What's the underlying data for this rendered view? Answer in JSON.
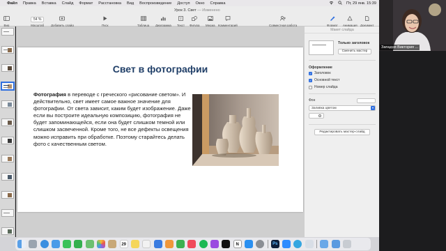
{
  "menubar": {
    "apple": "",
    "items": [
      "Файл",
      "Правка",
      "Вставка",
      "Слайд",
      "Формат",
      "Расстановка",
      "Вид",
      "Воспроизведение",
      "Доступ",
      "Окно",
      "Справка"
    ],
    "clock": "Пт, 29 янв. 15:39"
  },
  "document": {
    "title": "Урок 3. Свет",
    "status": "— Изменено"
  },
  "toolbar": {
    "view": "Вид",
    "zoom_value": "54 %",
    "zoom": "Масштаб",
    "add_slide": "Добавить слайд",
    "play": "Пуск",
    "table": "Таблица",
    "chart": "Диаграмма",
    "text": "Текст",
    "shape": "Фигура",
    "media": "Медиа",
    "comment": "Комментарий",
    "collaborate": "Совместная работа",
    "format": "Формат",
    "animate": "Анимация",
    "document": "Документ"
  },
  "slide": {
    "title": "Свет в фотографии",
    "body_term": "Фотография",
    "body_rest": " в переводе с греческого «рисование светом». И действительно, свет имеет самое важное значение для фотографии. От света зависит, каким будет изображение. Даже если вы построите идеальную композицию, фотография не будет запоминающейся, если она будет слишком темной или слишком засвеченной. Кроме того, не все дефекты освещения можно исправить при обработке. Поэтому старайтесь делать фото с качественным светом."
  },
  "inspector": {
    "header": "Макет слайда",
    "master_name": "Только заголовок",
    "change_master": "Сменить мастер",
    "appearance": "Оформление",
    "options": [
      {
        "label": "Заголовок",
        "checked": true
      },
      {
        "label": "Основной текст",
        "checked": true
      },
      {
        "label": "Номер слайда",
        "checked": false
      }
    ],
    "background": "Фон",
    "fill_type": "Заливка цветом",
    "edit_master": "Редактировать мастер-слайд"
  },
  "webcam": {
    "name": "Западня Виктория ..."
  },
  "dock": {
    "icons": [
      "finder-icon",
      "launchpad-icon",
      "safari-icon",
      "mail-icon",
      "messages-icon",
      "facetime-icon",
      "maps-icon",
      "photos-icon",
      "contacts-icon",
      "calendar-icon",
      "notes-icon",
      "reminders-icon",
      "keynote-icon",
      "pages-icon",
      "numbers-icon",
      "music-icon",
      "spotify-icon",
      "podcasts-icon",
      "tv-icon",
      "notion-icon",
      "appstore-icon",
      "settings-icon",
      "photoshop-icon",
      "zoom-icon",
      "telegram-icon",
      "preview-icon",
      "folder-icon",
      "downloads-icon",
      "trash-icon"
    ],
    "calendar_day": "29"
  },
  "colors": {
    "title": "#1f3e67",
    "accent": "#2f6fe0",
    "slide_bg": "#ffffff"
  }
}
